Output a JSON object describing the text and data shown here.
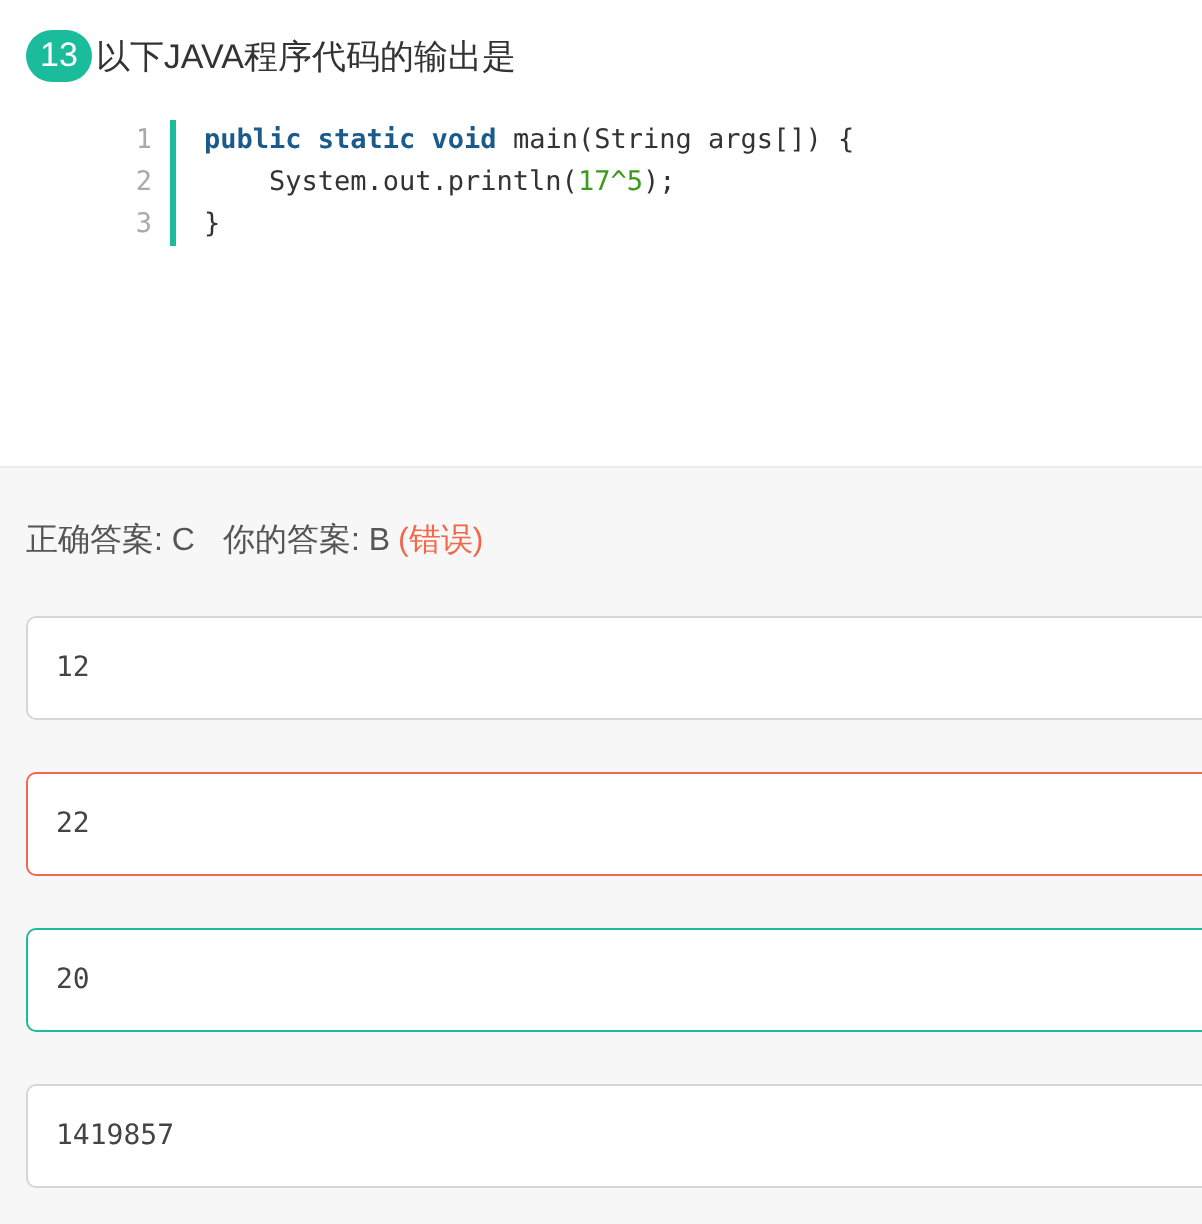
{
  "question": {
    "number": "13",
    "text": "以下JAVA程序代码的输出是"
  },
  "code": [
    {
      "number": "1",
      "tokens": [
        {
          "kind": "keyword",
          "text": "public static void"
        },
        {
          "kind": "plain",
          "text": " main(String args[]) {"
        }
      ]
    },
    {
      "number": "2",
      "tokens": [
        {
          "kind": "plain",
          "text": "    System.out.println("
        },
        {
          "kind": "number",
          "text": "17^5"
        },
        {
          "kind": "plain",
          "text": ");"
        }
      ]
    },
    {
      "number": "3",
      "tokens": [
        {
          "kind": "plain",
          "text": "}"
        }
      ]
    }
  ],
  "result": {
    "correct_label": "正确答案: C",
    "your_label": "你的答案: B",
    "verdict": "(错误)"
  },
  "options": [
    {
      "text": "12",
      "kind": "plain"
    },
    {
      "text": "22",
      "kind": "wrong"
    },
    {
      "text": "20",
      "kind": "correct"
    },
    {
      "text": "1419857",
      "kind": "plain"
    }
  ]
}
